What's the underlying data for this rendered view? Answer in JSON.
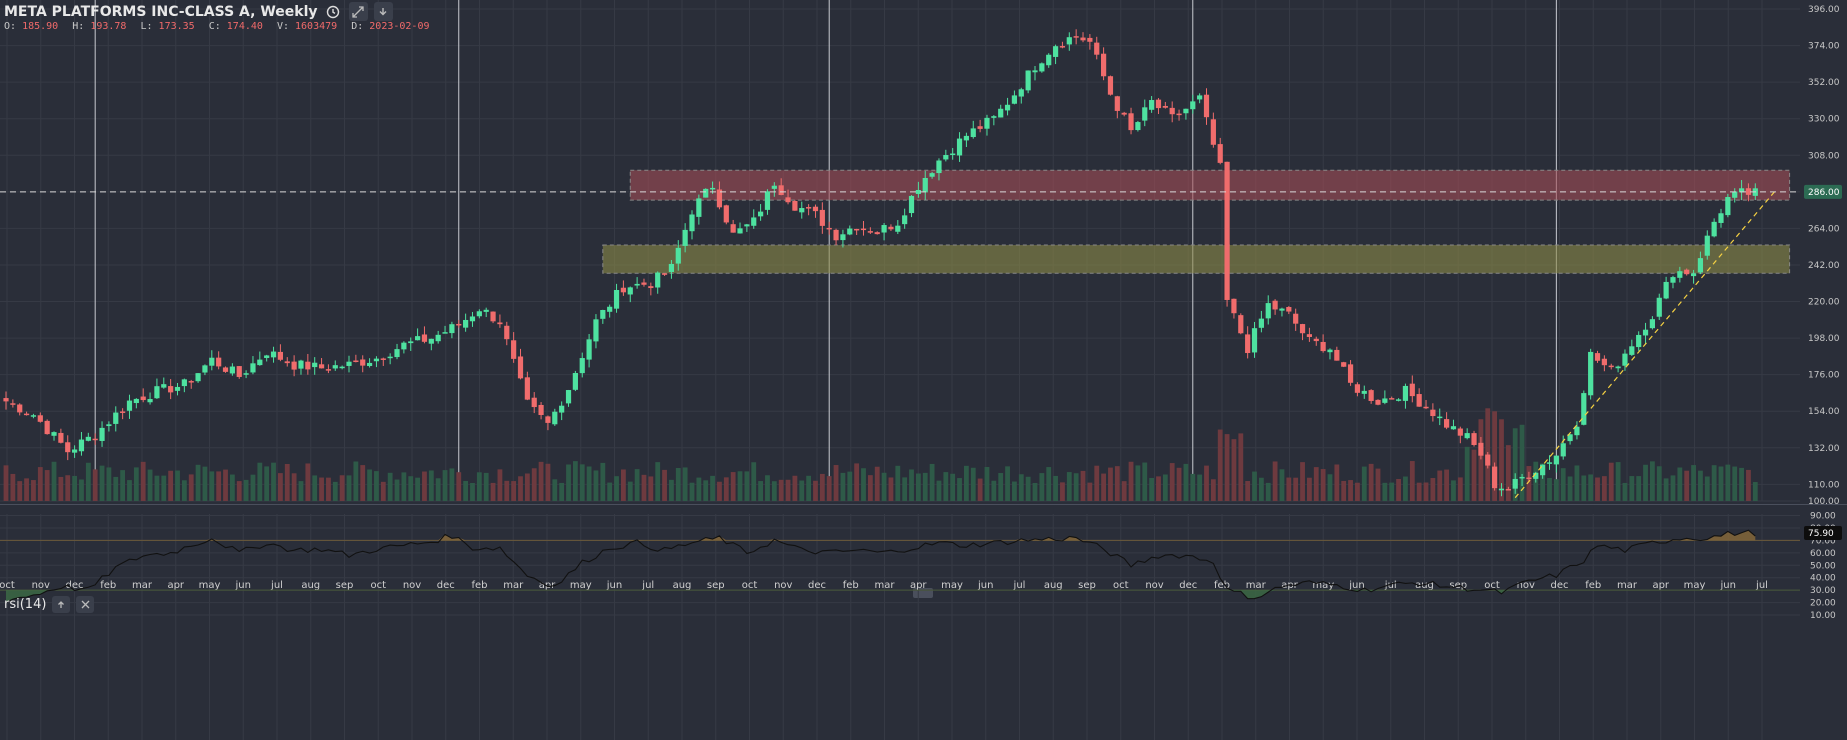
{
  "header": {
    "title": "META PLATFORMS INC-CLASS A, Weekly",
    "clock_icon": "clock-icon",
    "expand_icon": "expand-icon",
    "download_icon": "download-icon"
  },
  "ohlc": {
    "o_label": "O:",
    "o": "185.90",
    "h_label": "H:",
    "h": "193.78",
    "l_label": "L:",
    "l": "173.35",
    "c_label": "C:",
    "c": "174.40",
    "v_label": "V:",
    "v": "1603479",
    "d_label": "D:",
    "d": "2023-02-09"
  },
  "rsi_header": {
    "label": "rsi(14)",
    "up_icon": "arrow-up-icon",
    "close_icon": "close-icon"
  },
  "colors": {
    "background": "#2a2e39",
    "up": "#4ee2a0",
    "down": "#f06c6c",
    "grid": "#363a45",
    "resistance_zone": "#a34d57",
    "support_zone": "#8c8a48",
    "trendline": "#f5d142",
    "rsi_line": "#111111",
    "price_marker": "#2c6b53"
  },
  "chart_data": [
    {
      "type": "candlestick",
      "title": "META PLATFORMS INC-CLASS A, Weekly",
      "x_tick_labels": [
        "oct",
        "nov",
        "dec",
        "feb",
        "mar",
        "apr",
        "may",
        "jun",
        "jul",
        "aug",
        "sep",
        "oct",
        "nov",
        "dec",
        "feb",
        "mar",
        "apr",
        "may",
        "jun",
        "jul",
        "aug",
        "sep",
        "oct",
        "nov",
        "dec",
        "feb",
        "mar",
        "apr",
        "may",
        "jun",
        "jul",
        "aug",
        "sep",
        "oct",
        "nov",
        "dec",
        "feb",
        "mar",
        "apr",
        "may",
        "jun",
        "jul",
        "aug",
        "sep",
        "oct",
        "nov",
        "dec",
        "feb",
        "mar",
        "apr",
        "may",
        "jun",
        "jul"
      ],
      "y_ticks": [
        "396.00",
        "374.00",
        "352.00",
        "330.00",
        "308.00",
        "286.00",
        "264.00",
        "242.00",
        "220.00",
        "198.00",
        "176.00",
        "154.00",
        "132.00",
        "110.00",
        "100.00"
      ],
      "ylim": [
        100,
        396
      ],
      "current_price_label": "286.00",
      "current_price": 286,
      "zones": [
        {
          "name": "resistance",
          "from_week": 91,
          "to_week": 260,
          "low": 281,
          "high": 299
        },
        {
          "name": "support",
          "from_week": 87,
          "to_week": 260,
          "low": 237,
          "high": 254
        }
      ],
      "trendline": {
        "start": [
          220,
          102
        ],
        "end": [
          258,
          287
        ]
      },
      "year_separator_weeks": [
        13,
        66,
        120,
        173,
        226
      ],
      "price_anchors": [
        [
          0,
          160
        ],
        [
          4,
          152
        ],
        [
          9,
          130
        ],
        [
          13,
          140
        ],
        [
          18,
          160
        ],
        [
          22,
          166
        ],
        [
          26,
          170
        ],
        [
          30,
          185
        ],
        [
          34,
          175
        ],
        [
          38,
          190
        ],
        [
          42,
          182
        ],
        [
          46,
          180
        ],
        [
          50,
          182
        ],
        [
          54,
          186
        ],
        [
          58,
          194
        ],
        [
          62,
          198
        ],
        [
          66,
          206
        ],
        [
          69,
          216
        ],
        [
          72,
          208
        ],
        [
          76,
          158
        ],
        [
          79,
          146
        ],
        [
          82,
          168
        ],
        [
          86,
          208
        ],
        [
          90,
          229
        ],
        [
          94,
          231
        ],
        [
          97,
          240
        ],
        [
          100,
          275
        ],
        [
          103,
          290
        ],
        [
          106,
          260
        ],
        [
          109,
          268
        ],
        [
          112,
          292
        ],
        [
          115,
          278
        ],
        [
          118,
          272
        ],
        [
          121,
          260
        ],
        [
          124,
          266
        ],
        [
          127,
          262
        ],
        [
          130,
          268
        ],
        [
          133,
          290
        ],
        [
          136,
          305
        ],
        [
          140,
          320
        ],
        [
          144,
          330
        ],
        [
          147,
          345
        ],
        [
          150,
          362
        ],
        [
          153,
          375
        ],
        [
          156,
          380
        ],
        [
          158,
          376
        ],
        [
          161,
          345
        ],
        [
          164,
          322
        ],
        [
          167,
          340
        ],
        [
          170,
          330
        ],
        [
          174,
          342
        ],
        [
          177,
          300
        ],
        [
          178,
          220
        ],
        [
          181,
          192
        ],
        [
          184,
          218
        ],
        [
          187,
          212
        ],
        [
          190,
          196
        ],
        [
          193,
          192
        ],
        [
          196,
          170
        ],
        [
          200,
          160
        ],
        [
          204,
          166
        ],
        [
          207,
          157
        ],
        [
          210,
          146
        ],
        [
          213,
          138
        ],
        [
          215,
          128
        ],
        [
          217,
          110
        ],
        [
          219,
          107
        ],
        [
          221,
          114
        ],
        [
          224,
          122
        ],
        [
          226,
          128
        ],
        [
          229,
          148
        ],
        [
          231,
          188
        ],
        [
          234,
          178
        ],
        [
          237,
          195
        ],
        [
          240,
          212
        ],
        [
          243,
          238
        ],
        [
          246,
          238
        ],
        [
          249,
          268
        ],
        [
          251,
          282
        ],
        [
          253,
          285
        ]
      ],
      "volume_note": "histogram along bottom of price pane"
    },
    {
      "type": "line",
      "title": "rsi(14)",
      "y_ticks": [
        "90.00",
        "80.00",
        "70.00",
        "60.00",
        "50.00",
        "40.00",
        "30.00",
        "20.00",
        "10.00"
      ],
      "ylim": [
        5,
        95
      ],
      "overbought": 70,
      "oversold": 30,
      "current_value_label": "75.90",
      "current_value": 75.9,
      "anchors": [
        [
          0,
          22
        ],
        [
          4,
          26
        ],
        [
          8,
          33
        ],
        [
          12,
          30
        ],
        [
          16,
          48
        ],
        [
          20,
          58
        ],
        [
          24,
          60
        ],
        [
          28,
          68
        ],
        [
          30,
          72
        ],
        [
          34,
          60
        ],
        [
          38,
          68
        ],
        [
          42,
          62
        ],
        [
          46,
          63
        ],
        [
          50,
          58
        ],
        [
          54,
          63
        ],
        [
          58,
          66
        ],
        [
          62,
          69
        ],
        [
          65,
          74
        ],
        [
          68,
          64
        ],
        [
          72,
          64
        ],
        [
          76,
          42
        ],
        [
          80,
          33
        ],
        [
          84,
          52
        ],
        [
          88,
          64
        ],
        [
          92,
          68
        ],
        [
          96,
          62
        ],
        [
          100,
          68
        ],
        [
          104,
          72
        ],
        [
          108,
          60
        ],
        [
          112,
          70
        ],
        [
          116,
          62
        ],
        [
          120,
          60
        ],
        [
          124,
          62
        ],
        [
          128,
          60
        ],
        [
          132,
          64
        ],
        [
          136,
          68
        ],
        [
          140,
          66
        ],
        [
          144,
          68
        ],
        [
          148,
          70
        ],
        [
          152,
          71
        ],
        [
          156,
          72
        ],
        [
          160,
          63
        ],
        [
          164,
          50
        ],
        [
          168,
          58
        ],
        [
          172,
          58
        ],
        [
          176,
          53
        ],
        [
          178,
          30
        ],
        [
          182,
          24
        ],
        [
          186,
          33
        ],
        [
          190,
          36
        ],
        [
          194,
          34
        ],
        [
          198,
          30
        ],
        [
          202,
          34
        ],
        [
          206,
          36
        ],
        [
          210,
          33
        ],
        [
          214,
          31
        ],
        [
          218,
          28
        ],
        [
          222,
          37
        ],
        [
          226,
          42
        ],
        [
          230,
          54
        ],
        [
          232,
          66
        ],
        [
          236,
          62
        ],
        [
          240,
          68
        ],
        [
          244,
          72
        ],
        [
          248,
          72
        ],
        [
          252,
          76
        ],
        [
          256,
          76
        ]
      ]
    }
  ]
}
